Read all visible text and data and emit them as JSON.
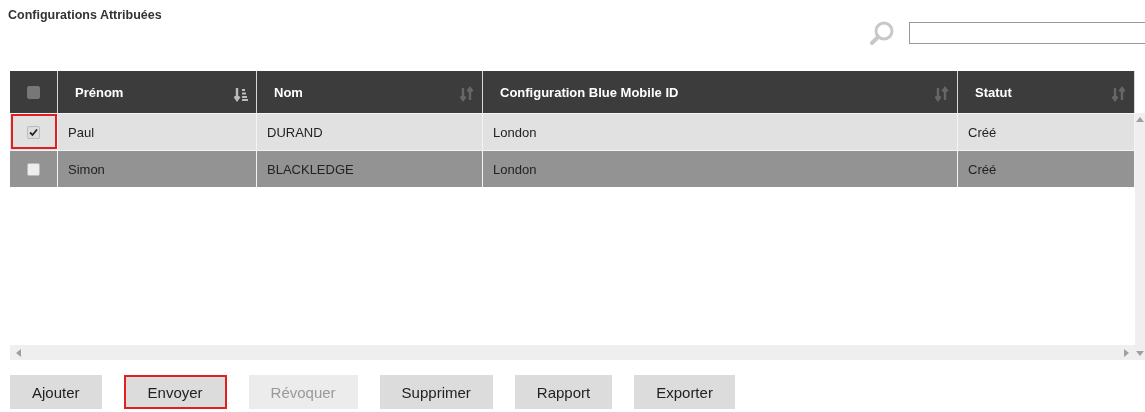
{
  "title": "Configurations Attribuées",
  "table": {
    "header_checkbox": {
      "checked": false
    },
    "columns": [
      {
        "label": "Prénom",
        "sort_active": true
      },
      {
        "label": "Nom",
        "sort_active": false
      },
      {
        "label": "Configuration Blue Mobile ID",
        "sort_active": false
      },
      {
        "label": "Statut",
        "sort_active": false
      }
    ],
    "rows": [
      {
        "checked": true,
        "highlighted": true,
        "selected": false,
        "cells": [
          "Paul",
          "DURAND",
          "London",
          "Créé"
        ]
      },
      {
        "checked": false,
        "highlighted": false,
        "selected": true,
        "cells": [
          "Simon",
          "BLACKLEDGE",
          "London",
          "Créé"
        ]
      }
    ]
  },
  "buttons": [
    {
      "label": "Ajouter",
      "disabled": false,
      "highlighted": false
    },
    {
      "label": "Envoyer",
      "disabled": false,
      "highlighted": true
    },
    {
      "label": "Révoquer",
      "disabled": true,
      "highlighted": false
    },
    {
      "label": "Supprimer",
      "disabled": false,
      "highlighted": false
    },
    {
      "label": "Rapport",
      "disabled": false,
      "highlighted": false
    },
    {
      "label": "Exporter",
      "disabled": false,
      "highlighted": false
    }
  ]
}
